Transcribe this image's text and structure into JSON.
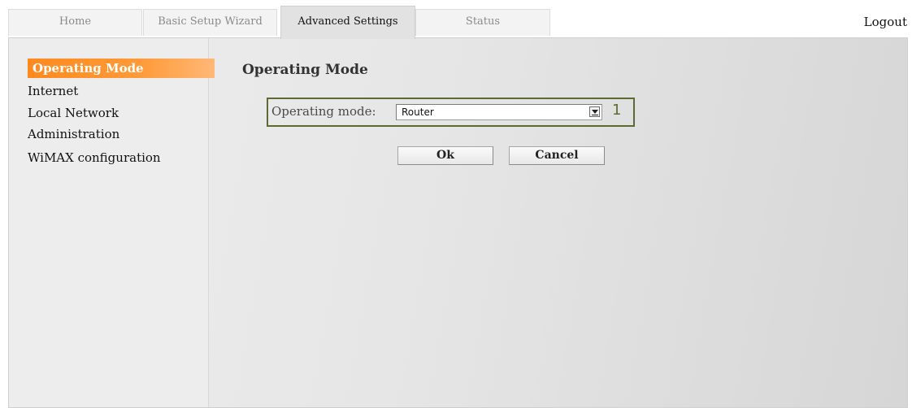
{
  "tabs": [
    {
      "label": "Home",
      "active": false
    },
    {
      "label": "Basic Setup Wizard",
      "active": false
    },
    {
      "label": "Advanced Settings",
      "active": true
    },
    {
      "label": "Status",
      "active": false
    }
  ],
  "header": {
    "logout_label": "Logout"
  },
  "sidebar": {
    "items": [
      {
        "label": "Operating Mode",
        "active": true
      },
      {
        "label": "Internet",
        "active": false
      },
      {
        "label": "Local Network",
        "active": false
      },
      {
        "label": "Administration",
        "active": false
      },
      {
        "label": "WiMAX configuration",
        "active": false
      }
    ]
  },
  "main": {
    "title": "Operating Mode",
    "field_label": "Operating mode:",
    "select_value": "Router",
    "callout_number": "1",
    "ok_label": "Ok",
    "cancel_label": "Cancel"
  },
  "colors": {
    "accent_orange": "#ff8a1e",
    "callout_green": "#5b6b31"
  },
  "icons": {
    "dropdown": "chevron-down-icon"
  }
}
